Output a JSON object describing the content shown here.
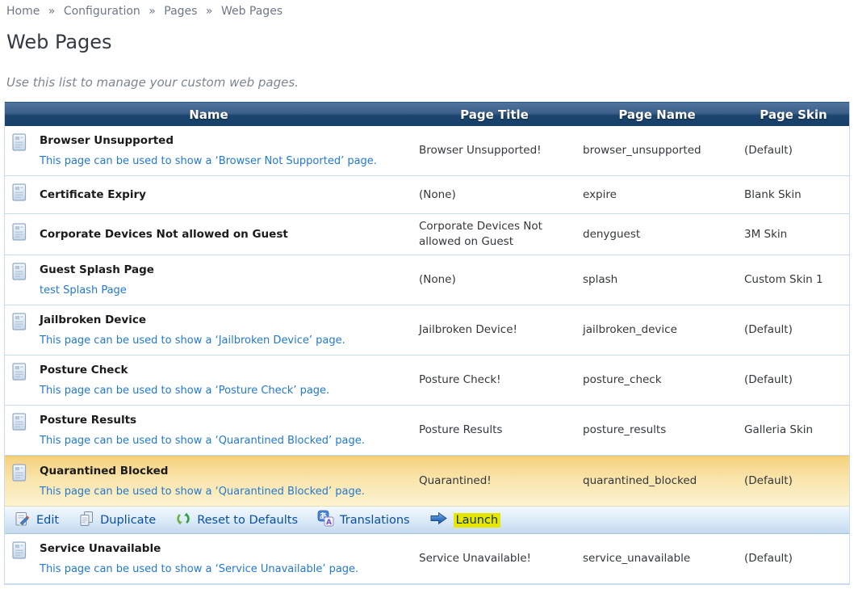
{
  "breadcrumb": {
    "items": [
      "Home",
      "Configuration",
      "Pages",
      "Web Pages"
    ],
    "separator": "»"
  },
  "page": {
    "title": "Web Pages",
    "description": "Use this list to manage your custom web pages."
  },
  "table": {
    "columns": [
      "Name",
      "Page Title",
      "Page Name",
      "Page Skin"
    ],
    "rows": [
      {
        "name": "Browser Unsupported",
        "subtitle": "This page can be used to show a ‘Browser Not Supported’ page.",
        "page_title": "Browser Unsupported!",
        "page_name": "browser_unsupported",
        "page_skin": "(Default)",
        "selected": false
      },
      {
        "name": "Certificate Expiry",
        "subtitle": "",
        "page_title": "(None)",
        "page_name": "expire",
        "page_skin": "Blank Skin",
        "selected": false
      },
      {
        "name": "Corporate Devices Not allowed on Guest",
        "subtitle": "",
        "page_title": "Corporate Devices Not allowed on Guest",
        "page_name": "denyguest",
        "page_skin": "3M Skin",
        "selected": false
      },
      {
        "name": "Guest Splash Page",
        "subtitle": "test Splash Page",
        "page_title": "(None)",
        "page_name": "splash",
        "page_skin": "Custom Skin 1",
        "selected": false
      },
      {
        "name": "Jailbroken Device",
        "subtitle": "This page can be used to show a ‘Jailbroken Device’ page.",
        "page_title": "Jailbroken Device!",
        "page_name": "jailbroken_device",
        "page_skin": "(Default)",
        "selected": false
      },
      {
        "name": "Posture Check",
        "subtitle": "This page can be used to show a ‘Posture Check’ page.",
        "page_title": "Posture Check!",
        "page_name": "posture_check",
        "page_skin": "(Default)",
        "selected": false
      },
      {
        "name": "Posture Results",
        "subtitle": "This page can be used to show a ‘Quarantined Blocked’ page.",
        "page_title": "Posture Results",
        "page_name": "posture_results",
        "page_skin": "Galleria Skin",
        "selected": false
      },
      {
        "name": "Quarantined Blocked",
        "subtitle": "This page can be used to show a ‘Quarantined Blocked’ page.",
        "page_title": "Quarantined!",
        "page_name": "quarantined_blocked",
        "page_skin": "(Default)",
        "selected": true
      },
      {
        "name": "Service Unavailable",
        "subtitle": "This page can be used to show a ‘Service Unavailable’ page.",
        "page_title": "Service Unavailable!",
        "page_name": "service_unavailable",
        "page_skin": "(Default)",
        "selected": false
      }
    ]
  },
  "action_bar": {
    "items": [
      {
        "label": "Edit",
        "highlight": false
      },
      {
        "label": "Duplicate",
        "highlight": false
      },
      {
        "label": "Reset to Defaults",
        "highlight": false
      },
      {
        "label": "Translations",
        "highlight": false
      },
      {
        "label": "Launch",
        "highlight": true
      }
    ]
  },
  "icons": {
    "translations_hiragana": "あ",
    "translations_letter": "A"
  },
  "colors": {
    "header_top": "#50749c",
    "header_bottom": "#173f68",
    "row_border": "#c9dbec",
    "selected_top": "#f5d17c",
    "selected_bottom": "#fdf3d0",
    "link_blue": "#2279d2",
    "action_text": "#0a4fa4",
    "launch_highlight": "#e5e700",
    "breadcrumb_gray": "#6d7886"
  }
}
